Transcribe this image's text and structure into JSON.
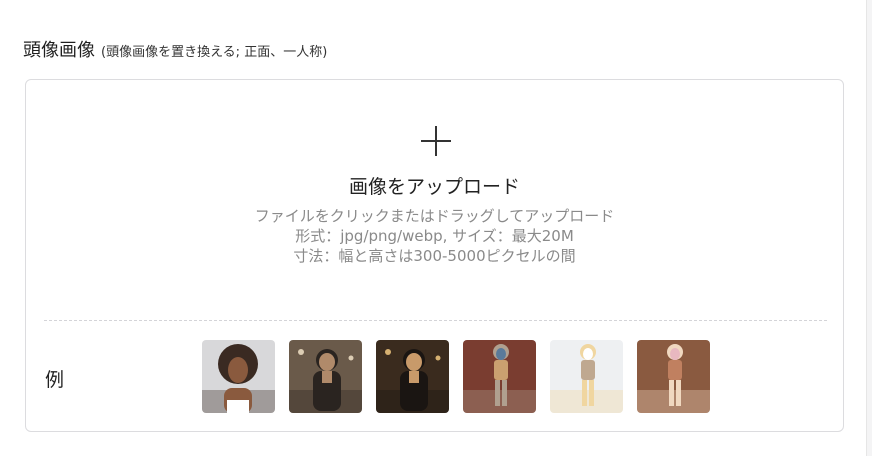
{
  "section": {
    "title": "頭像画像",
    "note": "(頭像画像を置き換える; 正面、一人称)"
  },
  "upload": {
    "title": "画像をアップロード",
    "hint_line1": "ファイルをクリックまたはドラッグしてアップロード",
    "hint_line2": "形式：jpg/png/webp, サイズ：最大20M",
    "hint_line3": "寸法：幅と高さは300-5000ピクセルの間",
    "icon": "plus-icon"
  },
  "examples": {
    "label": "例",
    "images": [
      {
        "name": "example-portrait-curly-hair",
        "palette": [
          "#d8d8da",
          "#3a2a22",
          "#8a5a3e",
          "#ffffff"
        ]
      },
      {
        "name": "example-man-in-cafe",
        "palette": [
          "#6a5a4a",
          "#2a2420",
          "#b08a6a",
          "#e9d9c0"
        ]
      },
      {
        "name": "example-woman-sequin-dress",
        "palette": [
          "#3a2b1e",
          "#1a1512",
          "#c89a6a",
          "#e8c07a"
        ]
      },
      {
        "name": "example-woman-brick-wall",
        "palette": [
          "#7a3d30",
          "#b0a090",
          "#5a7a9a",
          "#caa070"
        ]
      },
      {
        "name": "example-blonde-white-tee",
        "palette": [
          "#eef0f2",
          "#f0d6a0",
          "#ffffff",
          "#bfa890"
        ]
      },
      {
        "name": "example-woman-floral-dress",
        "palette": [
          "#8a5a40",
          "#f0d8c0",
          "#e8b8c0",
          "#c08060"
        ]
      }
    ]
  }
}
